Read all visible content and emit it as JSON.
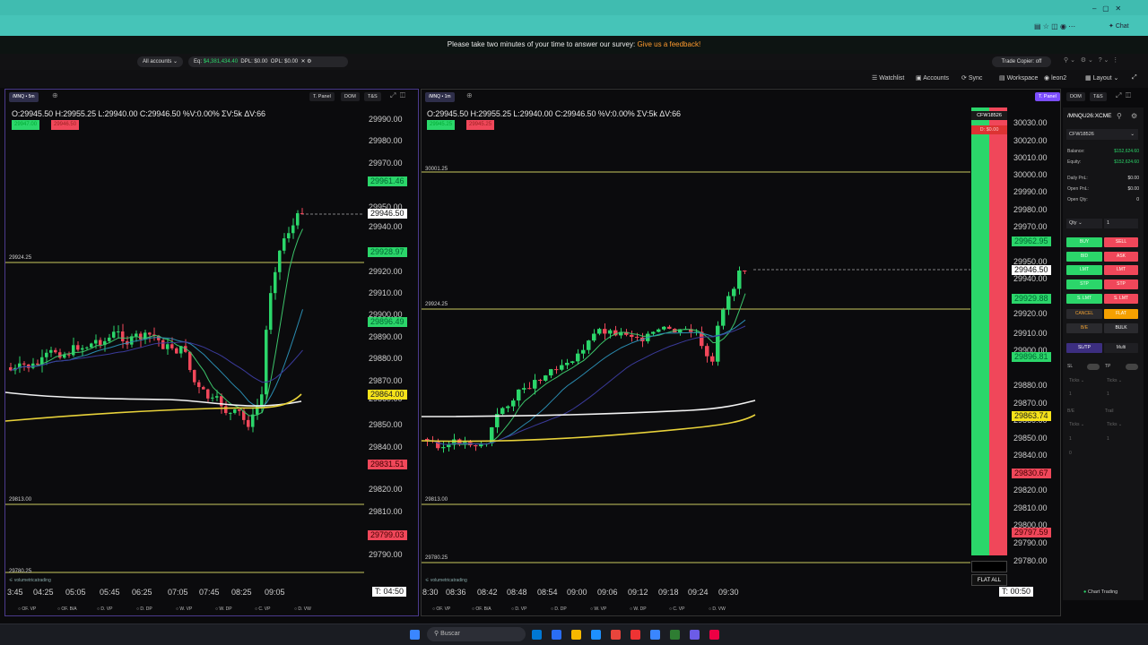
{
  "survey": {
    "text": "Please take two minutes of your time to answer our survey:",
    "link": "Give us a feedback!"
  },
  "browser": {
    "chat_label": "Chat"
  },
  "accountbar": {
    "accounts": "All accounts",
    "eq": "Eq: ",
    "eq_val": "$4,381,434.40",
    "dpl": "DPL: $0.00",
    "opl": "OPL: $0.00",
    "trade_copier": "Trade Copier: off"
  },
  "toolbar": {
    "watchlist": "Watchlist",
    "accounts": "Accounts",
    "sync": "Sync",
    "workspace": "Workspace",
    "user": "leon2",
    "layout": "Layout"
  },
  "chart1": {
    "symbol": "/MNQ • 5m",
    "buttons": [
      "T. Panel",
      "DOM",
      "T&S"
    ],
    "ohlc": "O:29945.50  H:29955.25  L:29940.00  C:29946.50  %V:0.00%  ΣV:5k  ΔV:66",
    "bid_tag": "29947.00",
    "ask_tag": "29946.50",
    "y_labels": [
      "29990.00",
      "29980.00",
      "29970.00",
      "29950.00",
      "29940.00",
      "29920.00",
      "29910.00",
      "29900.00",
      "29890.00",
      "29880.00",
      "29870.00",
      "29860.00",
      "29850.00",
      "29840.00",
      "29820.00",
      "29810.00",
      "29790.00"
    ],
    "price_tags": {
      "high": "29961.46",
      "last": "29946.50",
      "t3": "29928.97",
      "t4": "29896.49",
      "t5": "29864.00",
      "t6": "29831.51",
      "t7": "29799.03"
    },
    "levels": [
      "29924.25",
      "29813.00",
      "29780.25"
    ],
    "x_labels": [
      "3:45",
      "04:25",
      "05:05",
      "05:45",
      "06:25",
      "07:05",
      "07:45",
      "08:25",
      "09:05"
    ],
    "timer": "T: 04:50",
    "brand": "volumetricatrading",
    "profiles": [
      "OF. VP",
      "OF. B/A",
      "D. VP",
      "D. DP",
      "W. VP",
      "W. DP",
      "C. VP",
      "D. VW"
    ]
  },
  "chart2": {
    "symbol": "/MNQ • 1m",
    "ohlc": "O:29945.50  H:29955.25  L:29940.00  C:29946.50  %V:0.00%  ΣV:5k  ΔV:66",
    "bid_tag": "29945.25",
    "ask_tag": "29945.25",
    "y_labels": [
      "30030.00",
      "30020.00",
      "30010.00",
      "30000.00",
      "29990.00",
      "29980.00",
      "29970.00",
      "29950.00",
      "29940.00",
      "29920.00",
      "29910.00",
      "29900.00",
      "29880.00",
      "29870.00",
      "29860.00",
      "29850.00",
      "29840.00",
      "29820.00",
      "29810.00",
      "29800.00",
      "29790.00",
      "29780.00"
    ],
    "price_tags": {
      "high": "29962.95",
      "last": "29946.50",
      "t3": "29929.88",
      "t4": "29896.81",
      "t5": "29863.74",
      "t6": "29830.67",
      "t7": "29797.59"
    },
    "levels": [
      "30001.25",
      "29924.25",
      "29813.00",
      "29780.25"
    ],
    "x_labels": [
      "8:30",
      "08:36",
      "08:42",
      "08:48",
      "08:54",
      "09:00",
      "09:06",
      "09:12",
      "09:18",
      "09:24",
      "09:30"
    ],
    "timer": "T: 00:50",
    "dom_account": "CFW18526",
    "dom_pnl": "D: $0.00",
    "flat_all": "FLAT ALL"
  },
  "panel": {
    "symbol": "/MNQU26:XCME",
    "account": "CFW18526",
    "rows": [
      {
        "label": "Balance:",
        "value": "$152,624.60"
      },
      {
        "label": "Equity:",
        "value": "$152,624.60"
      },
      {
        "label": "Daily PnL:",
        "value": "$0.00"
      },
      {
        "label": "Open PnL:",
        "value": "$0.00"
      },
      {
        "label": "Open Qty:",
        "value": "0"
      }
    ],
    "qty_label": "Qty",
    "qty_value": "1",
    "buy": "BUY",
    "sell": "SELL",
    "bid": "BID",
    "ask": "ASK",
    "lmt": "LMT",
    "stp": "STP",
    "slmt": "S. LMT",
    "cancel": "CANCEL",
    "flat": "FLAT",
    "be": "B/E",
    "bulk": "BULK",
    "sltp": "SL/TP",
    "multi": "Multi",
    "sl": "SL",
    "tp": "TP",
    "ticks": "Ticks",
    "be2": "B/E",
    "trail": "Trail",
    "one": "1",
    "zero": "0",
    "chart_trading": "Chart Trading"
  },
  "taskbar": {
    "search": "Buscar"
  },
  "colors": {
    "up": "#2bd66a",
    "down": "#f0475a",
    "level": "#c8c860",
    "accent": "#40bcb0",
    "purple": "#7b4dff"
  }
}
